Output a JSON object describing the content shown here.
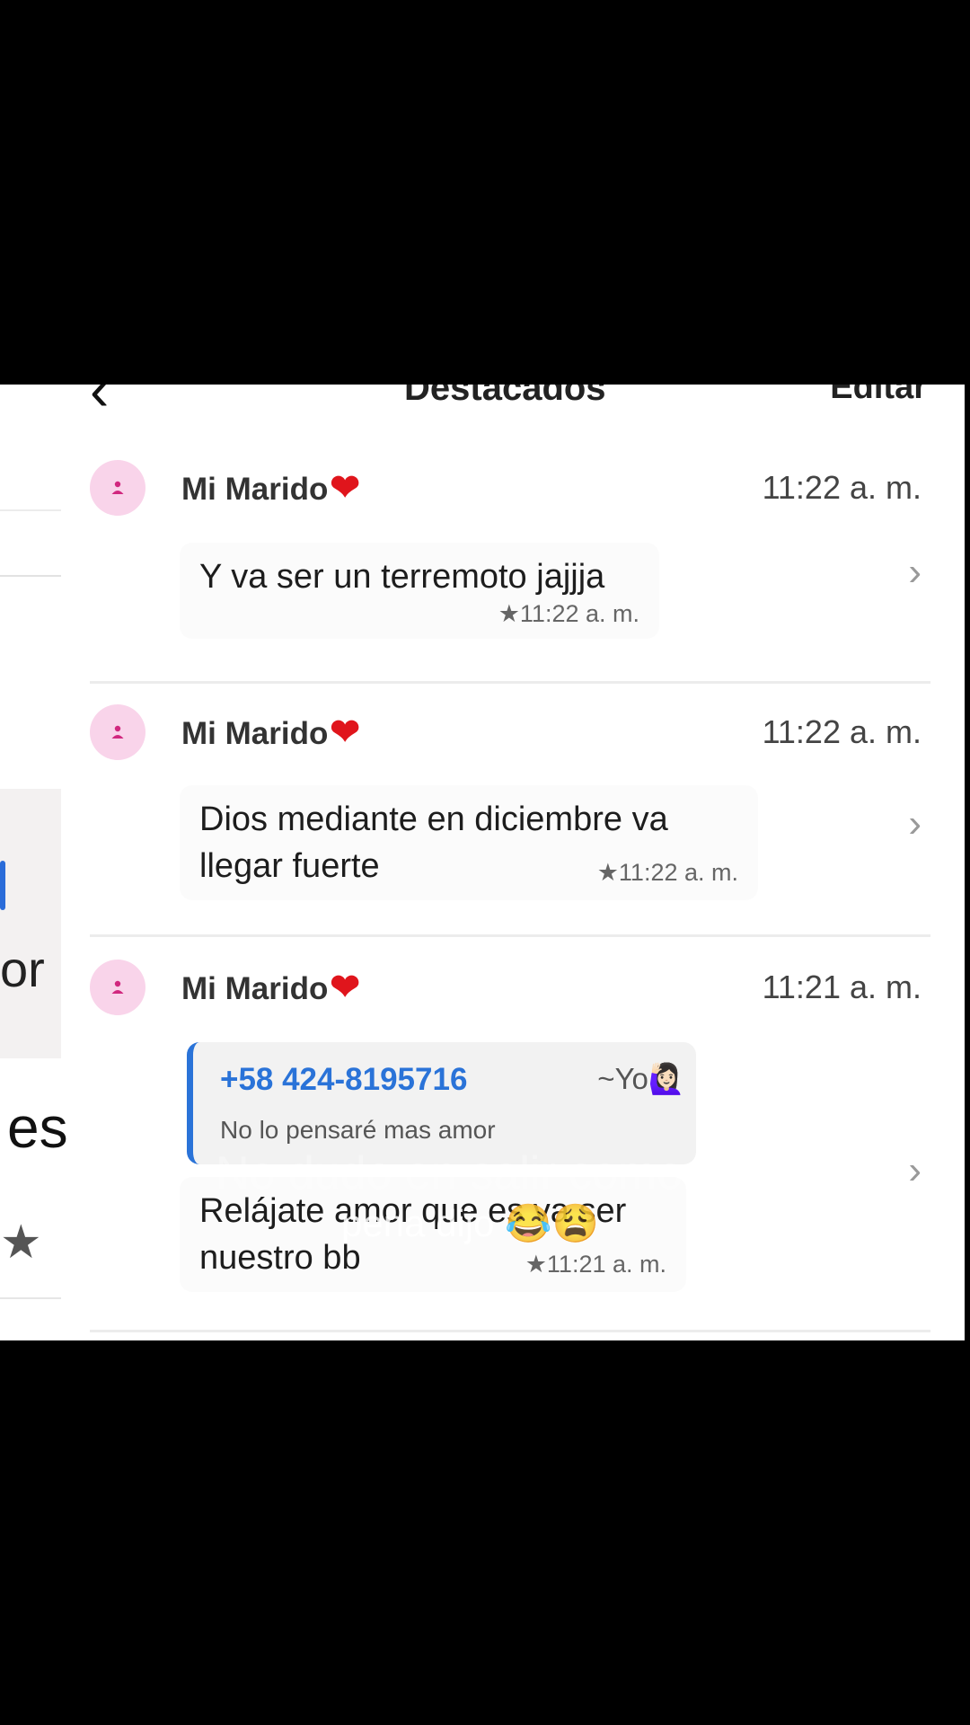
{
  "nav": {
    "back_icon": "chevron-left-icon",
    "title": "Destacados",
    "edit_label": "Editar"
  },
  "items": [
    {
      "sender": "Mi Marido",
      "sender_emoji": "❤️",
      "time": "11:22 a. m.",
      "message_line1": "Y va ser un terremoto jajjja",
      "message_line2": "",
      "stamp": "★11:22 a. m."
    },
    {
      "sender": "Mi Marido",
      "sender_emoji": "❤️",
      "time": "11:22 a. m.",
      "message_line1": "Dios mediante en diciembre va",
      "message_line2": "llegar fuerte",
      "stamp": "★11:22 a. m."
    },
    {
      "sender": "Mi Marido",
      "sender_emoji": "❤️",
      "time": "11:21 a. m.",
      "quote_phone": "+58 424-8195716",
      "quote_author": "~Yo🙋🏻‍♀️",
      "quote_text": "No lo pensaré mas amor",
      "message_line1": "Relájate amor que es va ser",
      "message_line2": "nuestro bb",
      "stamp": "★11:21 a. m."
    }
  ],
  "overlay": {
    "caption_line1": "No dudo en salir como",
    "caption_line2": "pena dijo 😂😩"
  },
  "left_strip": {
    "text_or": "or",
    "text_es": "es",
    "star": "★"
  },
  "colors": {
    "accent_blue": "#2a73d8",
    "heart_red": "#e0151c",
    "avatar_pink": "#f9d4ea"
  }
}
